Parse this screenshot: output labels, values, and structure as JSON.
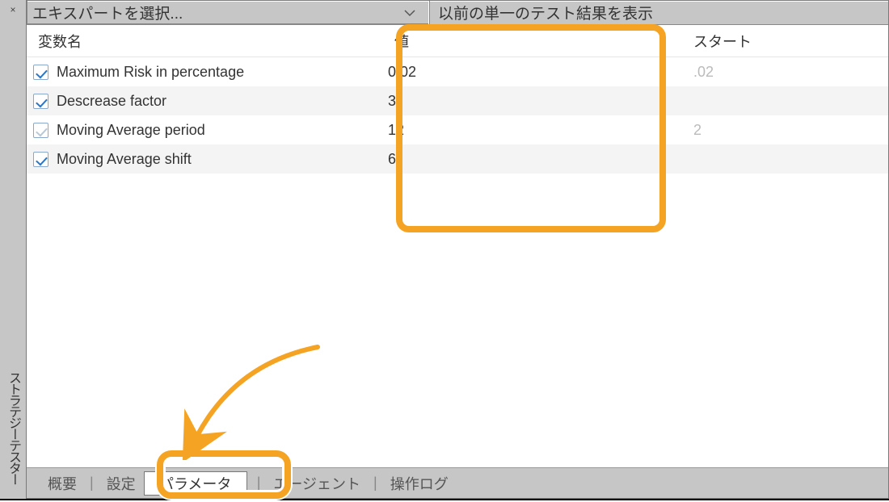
{
  "rail": {
    "close_glyph": "×",
    "title": "ストラテジーテスター"
  },
  "toolbar": {
    "expert_placeholder": "エキスパートを選択...",
    "prev_results": "以前の単一のテスト結果を表示"
  },
  "columns": {
    "name": "変数名",
    "value": "値",
    "start": "スタート"
  },
  "rows": [
    {
      "checked": true,
      "name": "Maximum Risk in percentage",
      "value": "0.02",
      "start": ".02"
    },
    {
      "checked": true,
      "name": "Descrease factor",
      "value": "3",
      "start": ""
    },
    {
      "checked": false,
      "name": "Moving Average period",
      "value": "12",
      "start": "2"
    },
    {
      "checked": true,
      "name": "Moving Average shift",
      "value": "6",
      "start": ""
    }
  ],
  "tabs": {
    "overview": "概要",
    "settings": "設定",
    "parameters": "パラメータ",
    "agents": "エージェント",
    "log": "操作ログ",
    "separator": "|"
  },
  "highlight_color": "#f5a323"
}
